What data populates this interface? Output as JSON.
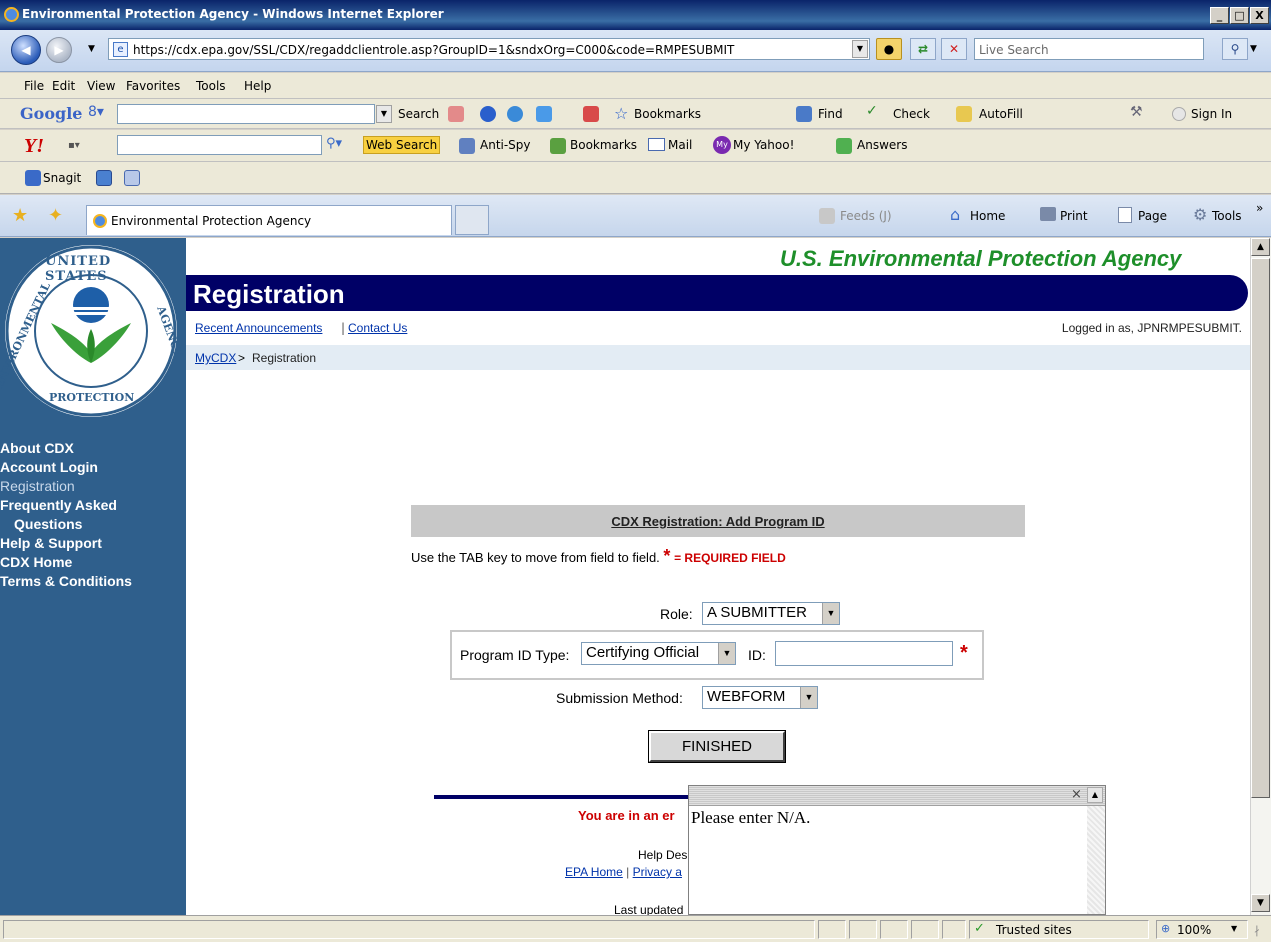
{
  "window": {
    "title": "Environmental Protection Agency - Windows Internet Explorer",
    "min": "_",
    "max": "□",
    "close": "X"
  },
  "address": {
    "url": "https://cdx.epa.gov/SSL/CDX/regaddclientrole.asp?GroupID=1&sndxOrg=C000&code=RMPESUBMIT",
    "search_placeholder": "Live Search"
  },
  "menu": [
    "File",
    "Edit",
    "View",
    "Favorites",
    "Tools",
    "Help"
  ],
  "google_toolbar": {
    "brand": "Google",
    "search": "Search",
    "bookmarks": "Bookmarks",
    "find": "Find",
    "check": "Check",
    "autofill": "AutoFill",
    "sign_in": "Sign In"
  },
  "yahoo_toolbar": {
    "web_search": "Web Search",
    "anti_spy": "Anti-Spy",
    "bookmarks": "Bookmarks",
    "mail": "Mail",
    "my_yahoo": "My Yahoo!",
    "answers": "Answers"
  },
  "snagit": {
    "label": "Snagit"
  },
  "tabs": {
    "active": "Environmental Protection Agency",
    "feeds": "Feeds (J)",
    "home": "Home",
    "print": "Print",
    "page": "Page",
    "tools": "Tools"
  },
  "page": {
    "agency": "U.S. Environmental Protection Agency",
    "section_title": "Registration",
    "top_links": [
      "Recent Announcements",
      "Contact Us"
    ],
    "logged_in": "Logged in as, JPNRMPESUBMIT.",
    "breadcrumb": {
      "link": "MyCDX",
      "current": "Registration"
    },
    "logo_text": {
      "top": "UNITED STATES",
      "left": "ENVIRONMENTAL",
      "bottom": "PROTECTION",
      "right": "AGENCY"
    },
    "nav": [
      {
        "label": "About CDX"
      },
      {
        "label": "Account Login"
      },
      {
        "label": "Registration",
        "active": true
      },
      {
        "label": "Frequently Asked"
      },
      {
        "label": "Questions"
      },
      {
        "label": "Help & Support"
      },
      {
        "label": "CDX Home"
      },
      {
        "label": "Terms & Conditions"
      }
    ],
    "form": {
      "heading": "CDX Registration: Add Program ID",
      "instructions": "Use the TAB key to move from field to field.",
      "required_marker": "*",
      "required_text": "= REQUIRED FIELD",
      "role_label": "Role:",
      "role_value": "A SUBMITTER",
      "program_id_type_label": "Program ID Type:",
      "program_id_type_value": "Certifying Official",
      "id_label": "ID:",
      "id_value": "",
      "submission_method_label": "Submission Method:",
      "submission_method_value": "WEBFORM",
      "finished_button": "FINISHED"
    },
    "footer": {
      "warning": "You are in an er",
      "help_desk": "Help Des",
      "links": [
        "EPA Home",
        "Privacy a"
      ],
      "last_updated": "Last updated"
    }
  },
  "popup": {
    "text": "Please enter N/A.",
    "close": "×"
  },
  "status": {
    "zone": "Trusted sites",
    "zoom": "100%"
  },
  "colors": {
    "nav_bg": "#2f5f8c",
    "header_bar": "#000066",
    "agency_green": "#1e8f2a",
    "required_red": "#cc0000"
  }
}
